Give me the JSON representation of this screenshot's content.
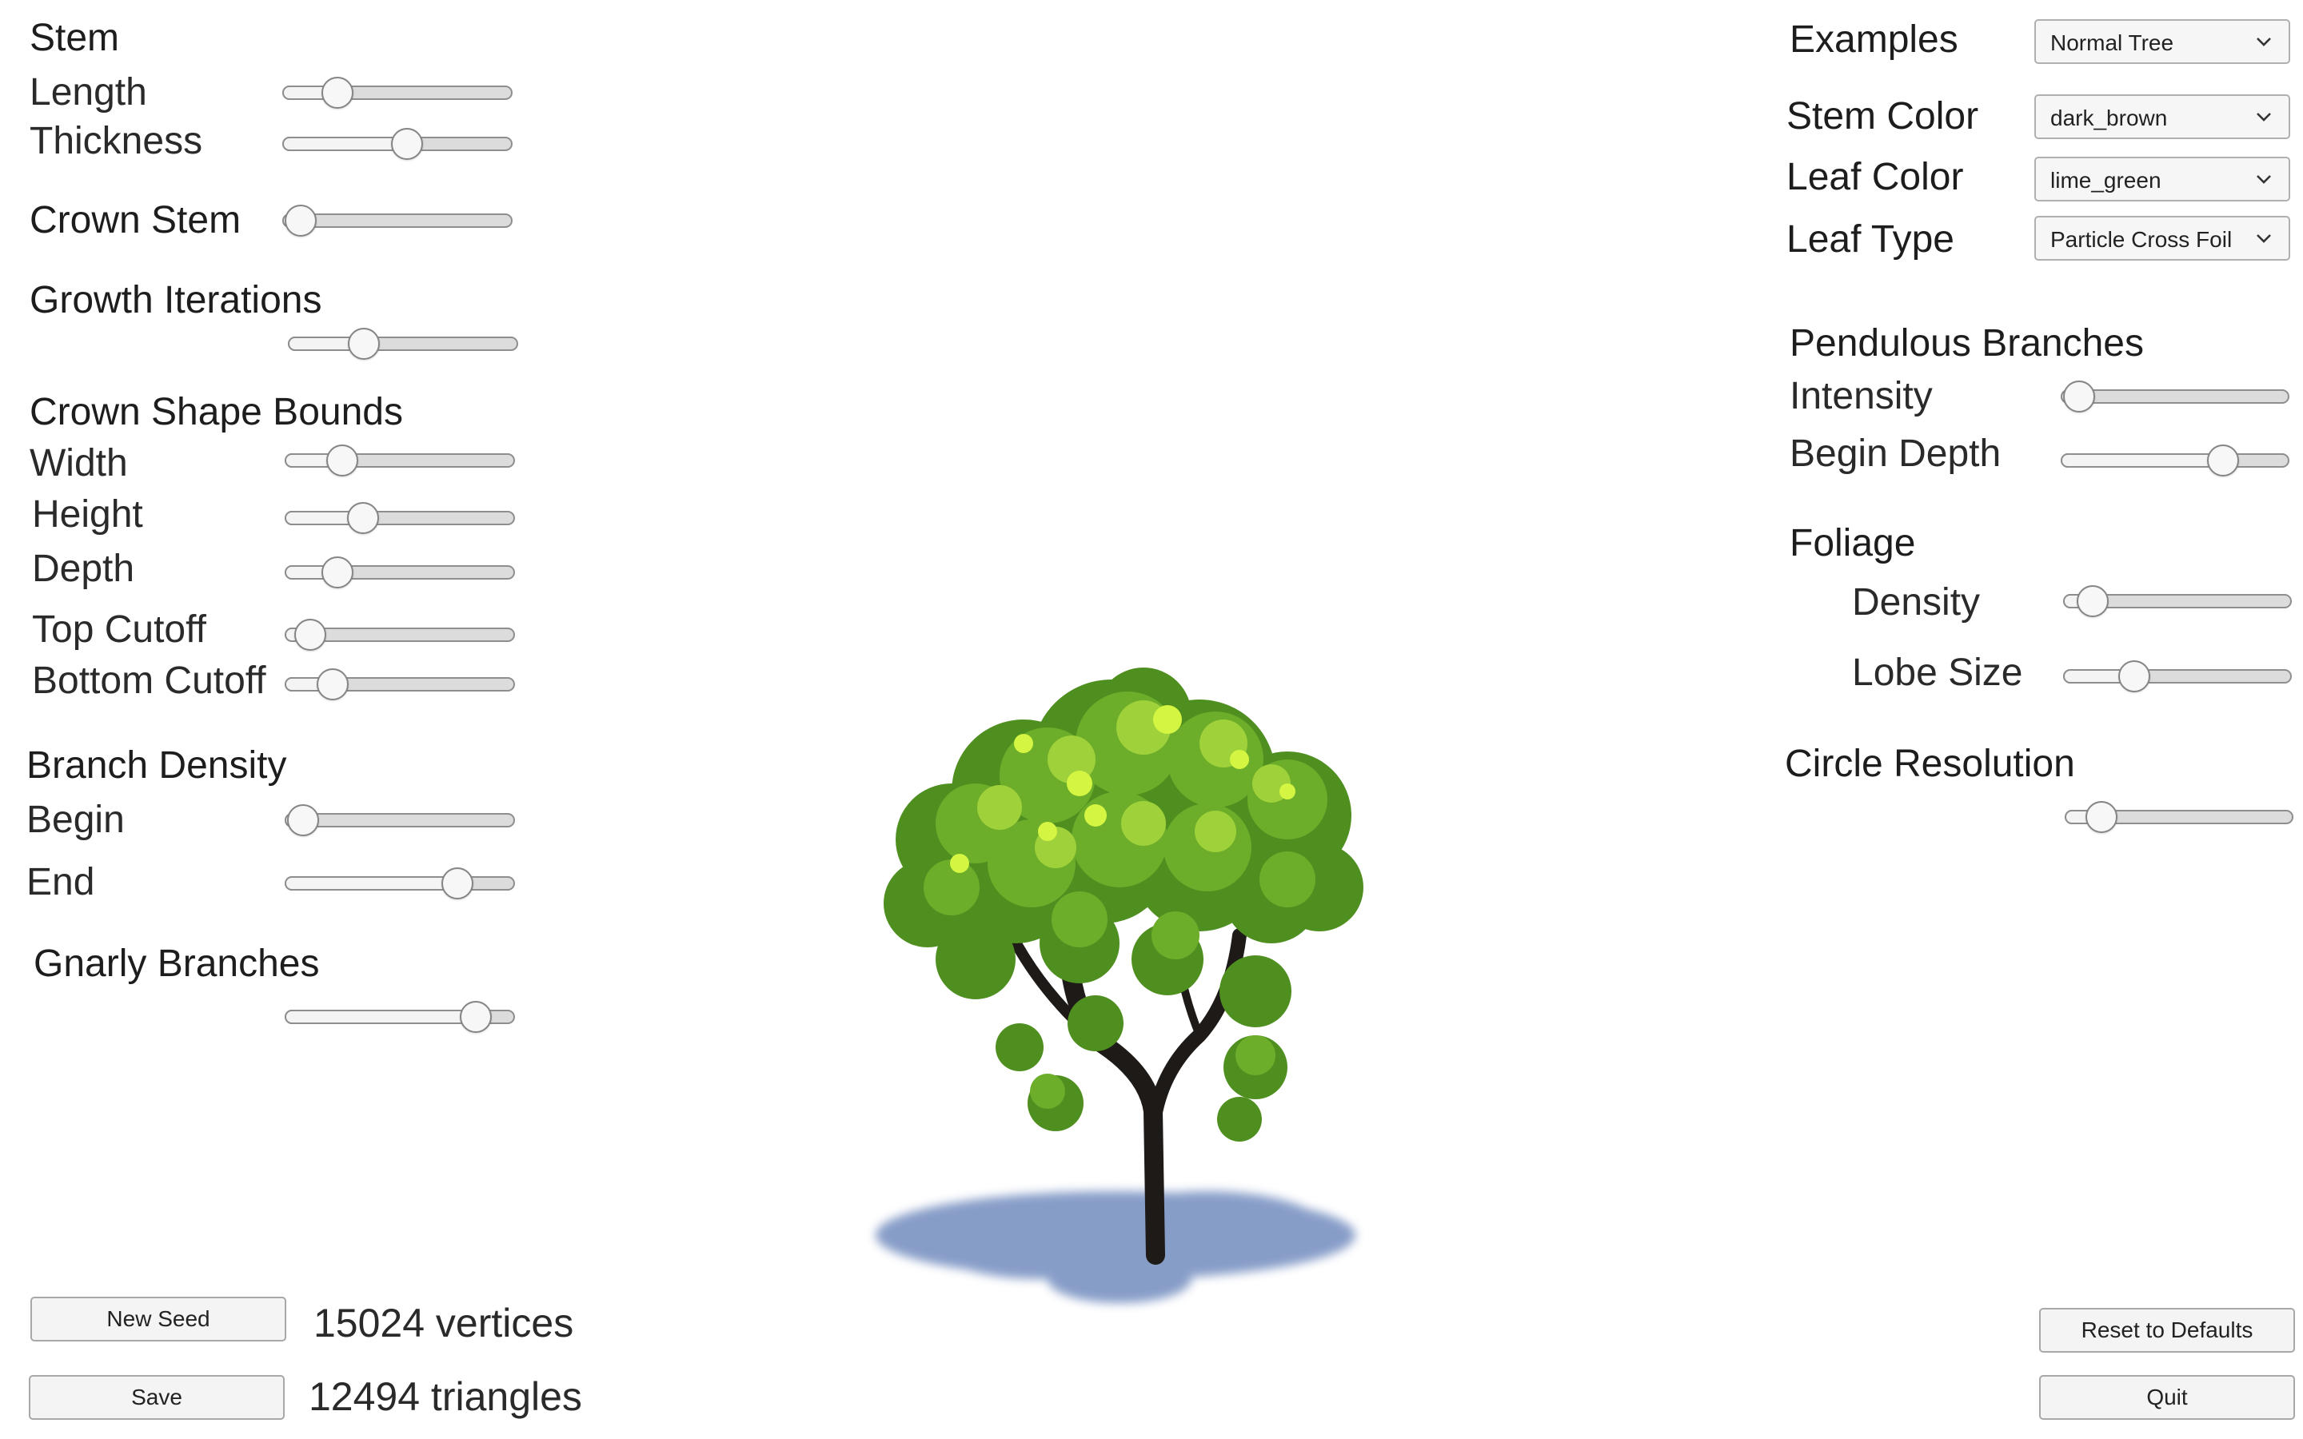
{
  "left_panel": {
    "stem": {
      "header": "Stem",
      "length_label": "Length",
      "length_value": 0.24,
      "thickness_label": "Thickness",
      "thickness_value": 0.54
    },
    "crown_stem": {
      "header": "Crown Stem",
      "value": 0.08
    },
    "growth_iterations": {
      "header": "Growth Iterations",
      "value": 0.33
    },
    "crown_shape_bounds": {
      "header": "Crown Shape Bounds",
      "width_label": "Width",
      "width_value": 0.25,
      "height_label": "Height",
      "height_value": 0.34,
      "depth_label": "Depth",
      "depth_value": 0.23,
      "top_cutoff_label": "Top Cutoff",
      "top_cutoff_value": 0.11,
      "bottom_cutoff_label": "Bottom Cutoff",
      "bottom_cutoff_value": 0.21
    },
    "branch_density": {
      "header": "Branch Density",
      "begin_label": "Begin",
      "begin_value": 0.08,
      "end_label": "End",
      "end_value": 0.75
    },
    "gnarly_branches": {
      "header": "Gnarly Branches",
      "value": 0.83
    }
  },
  "right_panel": {
    "examples_label": "Examples",
    "examples_value": "Normal Tree",
    "stem_color_label": "Stem Color",
    "stem_color_value": "dark_brown",
    "leaf_color_label": "Leaf Color",
    "leaf_color_value": "lime_green",
    "leaf_type_label": "Leaf Type",
    "leaf_type_value": "Particle Cross Foil",
    "pendulous": {
      "header": "Pendulous Branches",
      "intensity_label": "Intensity",
      "intensity_value": 0.08,
      "begin_depth_label": "Begin Depth",
      "begin_depth_value": 0.71
    },
    "foliage": {
      "header": "Foliage",
      "density_label": "Density",
      "density_value": 0.13,
      "lobe_size_label": "Lobe Size",
      "lobe_size_value": 0.31
    },
    "circle_resolution": {
      "header": "Circle Resolution",
      "value": 0.16
    }
  },
  "footer": {
    "new_seed_label": "New Seed",
    "save_label": "Save",
    "vertices_text": "15024 vertices",
    "triangles_text": "12494 triangles",
    "reset_label": "Reset to Defaults",
    "quit_label": "Quit"
  },
  "colors": {
    "leaf": "#6cad2a",
    "leaf_highlight": "#d4f542",
    "trunk": "#1e1a18",
    "shadow": "#7a93c2"
  },
  "icons": {
    "dropdown_chevron": "chevron-down-icon"
  }
}
